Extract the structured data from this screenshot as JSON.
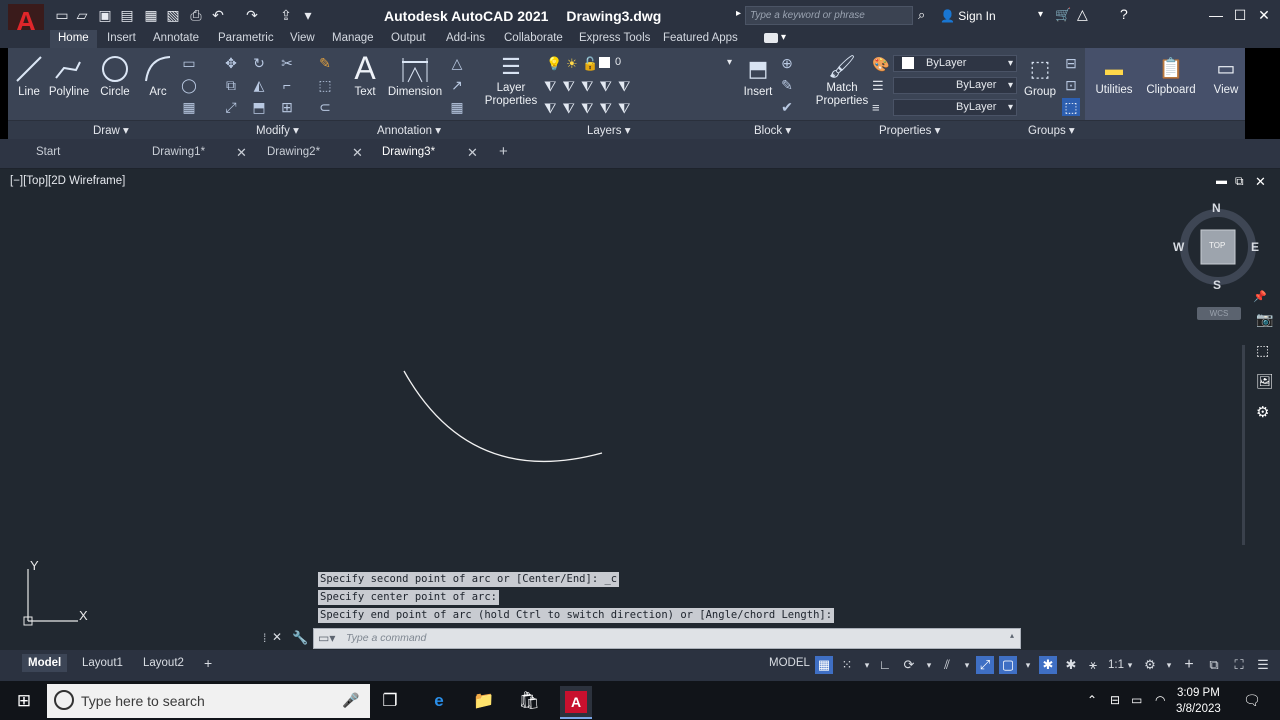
{
  "window": {
    "app_title": "Autodesk AutoCAD 2021",
    "doc_title": "Drawing3.dwg",
    "search_placeholder": "Type a keyword or phrase",
    "signin": "Sign In",
    "logo": "A"
  },
  "ribbon_tabs": [
    "Home",
    "Insert",
    "Annotate",
    "Parametric",
    "View",
    "Manage",
    "Output",
    "Add-ins",
    "Collaborate",
    "Express Tools",
    "Featured Apps"
  ],
  "draw": {
    "line": "Line",
    "polyline": "Polyline",
    "circle": "Circle",
    "arc": "Arc",
    "panel": "Draw"
  },
  "modify": {
    "panel": "Modify"
  },
  "annotation": {
    "text": "Text",
    "dimension": "Dimension",
    "panel": "Annotation"
  },
  "layers": {
    "layer_properties_1": "Layer",
    "layer_properties_2": "Properties",
    "current_layer": "0",
    "panel": "Layers"
  },
  "block": {
    "insert": "Insert",
    "panel": "Block"
  },
  "properties": {
    "match_1": "Match",
    "match_2": "Properties",
    "color": "ByLayer",
    "linetype": "ByLayer",
    "lineweight": "ByLayer",
    "panel": "Properties"
  },
  "groups": {
    "group": "Group",
    "panel": "Groups"
  },
  "utilities": {
    "label": "Utilities"
  },
  "clipboard": {
    "label": "Clipboard"
  },
  "view_panel": {
    "label": "View"
  },
  "doc_tabs": [
    "Start",
    "Drawing1*",
    "Drawing2*",
    "Drawing3*"
  ],
  "viewport": {
    "label": "[−][Top][2D Wireframe]",
    "compass": {
      "n": "N",
      "s": "S",
      "e": "E",
      "w": "W",
      "top": "TOP"
    },
    "wcs": "WCS",
    "ucs_y": "Y",
    "ucs_x": "X"
  },
  "command": {
    "history": [
      "Specify second point of arc or [Center/End]: _c",
      "Specify center point of arc:",
      "Specify end point of arc (hold Ctrl to switch direction) or [Angle/chord Length]:"
    ],
    "placeholder": "Type a command"
  },
  "layout_tabs": [
    "Model",
    "Layout1",
    "Layout2"
  ],
  "status": {
    "model": "MODEL",
    "scale": "1:1"
  },
  "taskbar": {
    "search": "Type here to search",
    "time": "3:09 PM",
    "date": "3/8/2023"
  },
  "colors": {
    "canvas": "#212830",
    "ribbon": "#3b4455",
    "accent": "#3f6fc4",
    "logo": "#e0262a"
  }
}
